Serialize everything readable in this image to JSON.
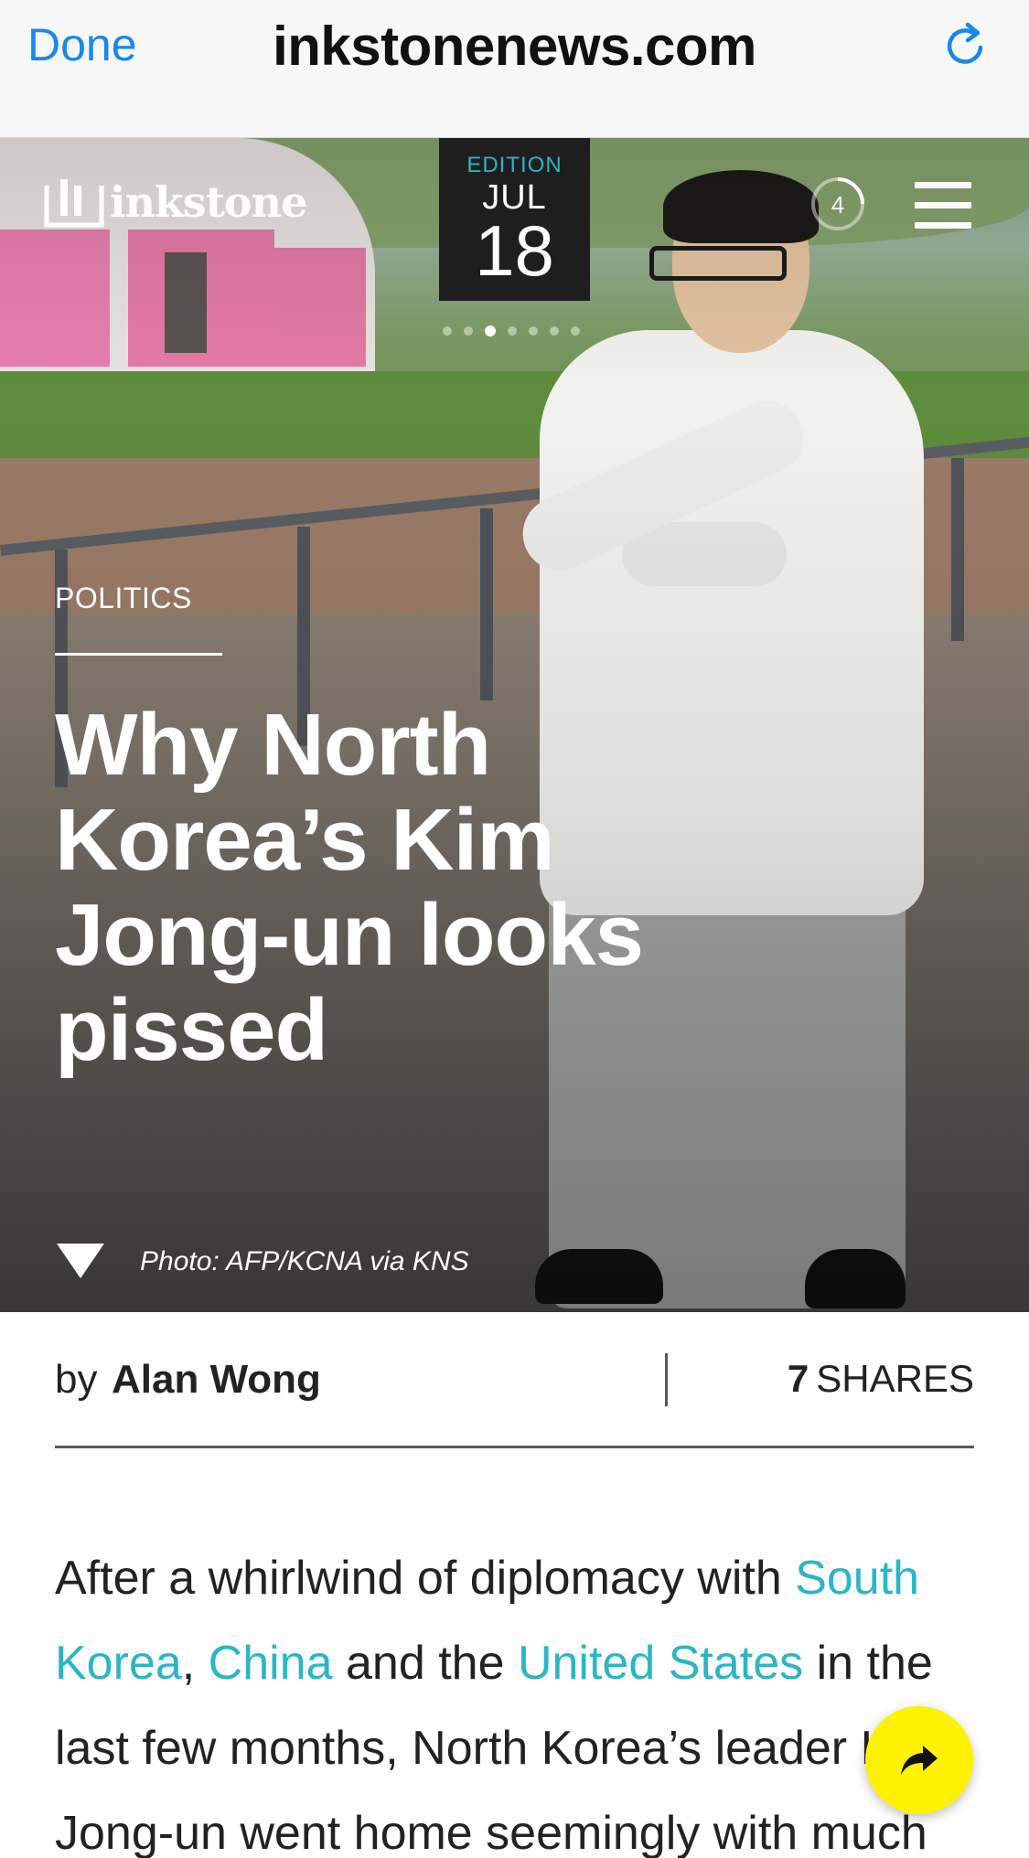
{
  "browser": {
    "done_label": "Done",
    "domain": "inkstonenews.com",
    "reload_icon": "reload-icon",
    "accent": "#1a86f0"
  },
  "hero": {
    "logo_text": "inkstone",
    "edition": {
      "label": "EDITION",
      "month": "JUL",
      "day": "18"
    },
    "pager": {
      "count": 7,
      "active": 2
    },
    "counter": "4",
    "category": "POLITICS",
    "headline": "Why North Korea’s Kim Jong-un looks pissed",
    "photo_credit": "Photo: AFP/KCNA via KNS"
  },
  "byline": {
    "by": "by",
    "author": "Alan Wong",
    "shares_count": "7",
    "shares_label": "SHARES"
  },
  "article": {
    "p1_a": "After a whirlwind of diplomacy with ",
    "link_south_korea": "South Korea",
    "p1_b": ", ",
    "link_china": "China",
    "p1_c": " and the ",
    "link_us": "United States",
    "p1_d": " in the last few months, North Korea’s leader Kim Jong-un went home seemingly with much",
    "link_color": "#2bb5c6"
  },
  "share_button": {
    "icon": "share-arrow-icon",
    "color": "#fff200"
  }
}
